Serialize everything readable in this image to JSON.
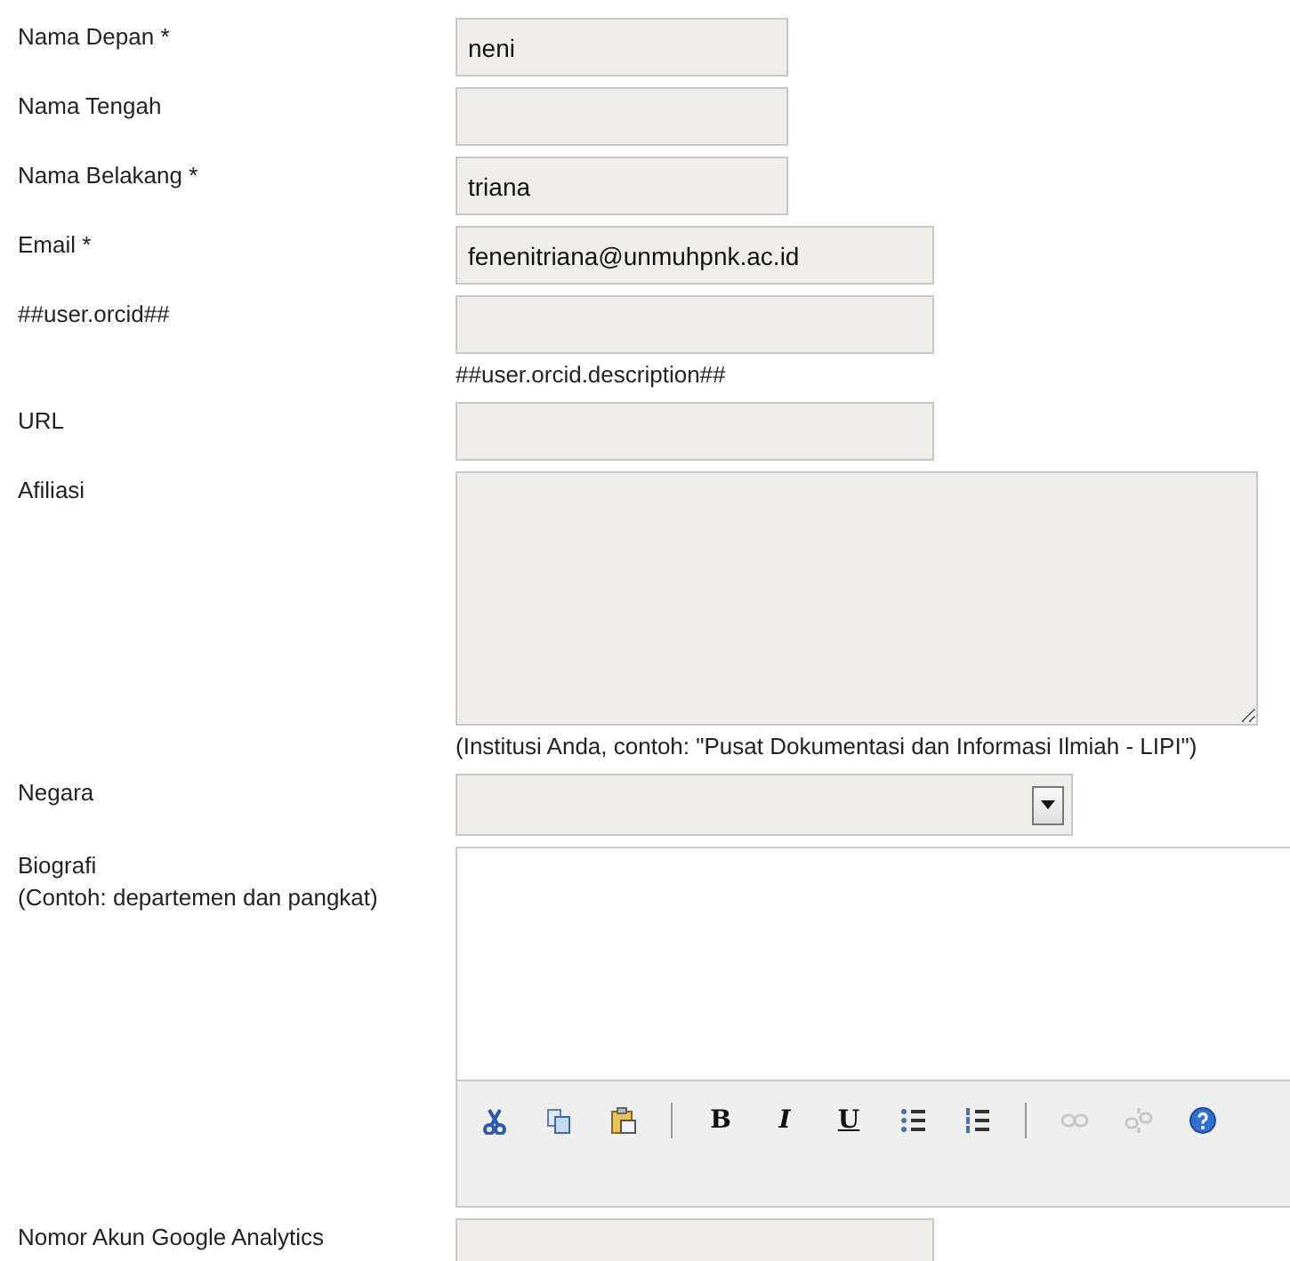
{
  "fields": [
    {
      "kind": "text",
      "label": "Nama Depan *",
      "value": "neni"
    },
    {
      "kind": "text",
      "label": "Nama Tengah"
    },
    {
      "kind": "text",
      "label": "Nama Belakang *",
      "value": "triana"
    },
    {
      "kind": "text",
      "label": "Email *",
      "value": "fenenitriana@unmuhpnk.ac.id"
    },
    {
      "kind": "text",
      "label": "##user.orcid##",
      "hint": "##user.orcid.description##"
    },
    {
      "kind": "text",
      "label": "URL"
    },
    {
      "kind": "textarea",
      "label": "Afiliasi",
      "hint": "(Institusi Anda, contoh: \"Pusat Dokumentasi dan Informasi Ilmiah - LIPI\")"
    },
    {
      "kind": "select",
      "label": "Negara"
    },
    {
      "kind": "editor",
      "label": "Biografi",
      "note": "(Contoh: departemen dan pangkat)",
      "toolbar": [
        {
          "kind": "cut",
          "disabled": false
        },
        {
          "kind": "copy",
          "disabled": false
        },
        {
          "kind": "paste",
          "disabled": false
        },
        {
          "kind": "separator"
        },
        {
          "kind": "bold",
          "label": "B",
          "disabled": false
        },
        {
          "kind": "italic",
          "label": "I",
          "disabled": false
        },
        {
          "kind": "underline",
          "label": "U",
          "disabled": false
        },
        {
          "kind": "bullets",
          "disabled": false
        },
        {
          "kind": "numbers",
          "disabled": false
        },
        {
          "kind": "separator"
        },
        {
          "kind": "link",
          "disabled": true
        },
        {
          "kind": "unlink",
          "disabled": true
        },
        {
          "kind": "help",
          "disabled": false
        }
      ]
    },
    {
      "kind": "text",
      "label": "Nomor Akun Google Analytics"
    }
  ]
}
